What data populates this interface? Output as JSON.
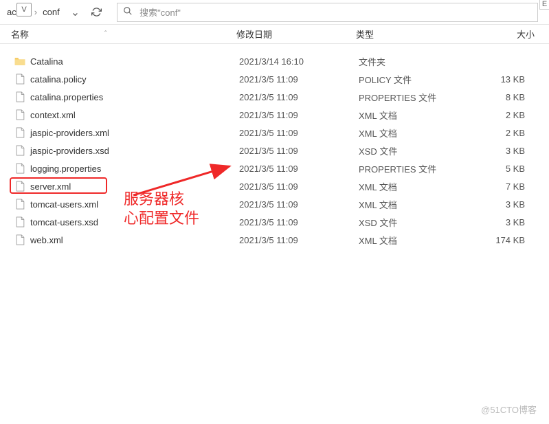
{
  "toolbar": {
    "v_badge": "V",
    "breadcrumb": {
      "parent": "ach...",
      "current": "conf"
    },
    "search_placeholder": "搜索\"conf\""
  },
  "columns": {
    "name": "名称",
    "date": "修改日期",
    "type": "类型",
    "size": "大小"
  },
  "files": [
    {
      "name": "Catalina",
      "date": "2021/3/14 16:10",
      "type": "文件夹",
      "size": "",
      "icon": "folder"
    },
    {
      "name": "catalina.policy",
      "date": "2021/3/5 11:09",
      "type": "POLICY 文件",
      "size": "13 KB",
      "icon": "file"
    },
    {
      "name": "catalina.properties",
      "date": "2021/3/5 11:09",
      "type": "PROPERTIES 文件",
      "size": "8 KB",
      "icon": "file"
    },
    {
      "name": "context.xml",
      "date": "2021/3/5 11:09",
      "type": "XML 文档",
      "size": "2 KB",
      "icon": "file"
    },
    {
      "name": "jaspic-providers.xml",
      "date": "2021/3/5 11:09",
      "type": "XML 文档",
      "size": "2 KB",
      "icon": "file"
    },
    {
      "name": "jaspic-providers.xsd",
      "date": "2021/3/5 11:09",
      "type": "XSD 文件",
      "size": "3 KB",
      "icon": "file"
    },
    {
      "name": "logging.properties",
      "date": "2021/3/5 11:09",
      "type": "PROPERTIES 文件",
      "size": "5 KB",
      "icon": "file"
    },
    {
      "name": "server.xml",
      "date": "2021/3/5 11:09",
      "type": "XML 文档",
      "size": "7 KB",
      "icon": "file",
      "highlighted": true
    },
    {
      "name": "tomcat-users.xml",
      "date": "2021/3/5 11:09",
      "type": "XML 文档",
      "size": "3 KB",
      "icon": "file"
    },
    {
      "name": "tomcat-users.xsd",
      "date": "2021/3/5 11:09",
      "type": "XSD 文件",
      "size": "3 KB",
      "icon": "file"
    },
    {
      "name": "web.xml",
      "date": "2021/3/5 11:09",
      "type": "XML 文档",
      "size": "174 KB",
      "icon": "file"
    }
  ],
  "annotation": {
    "line1": "服务器核",
    "line2": "心配置文件"
  },
  "watermark": "@51CTO博客",
  "right_badge": "E"
}
